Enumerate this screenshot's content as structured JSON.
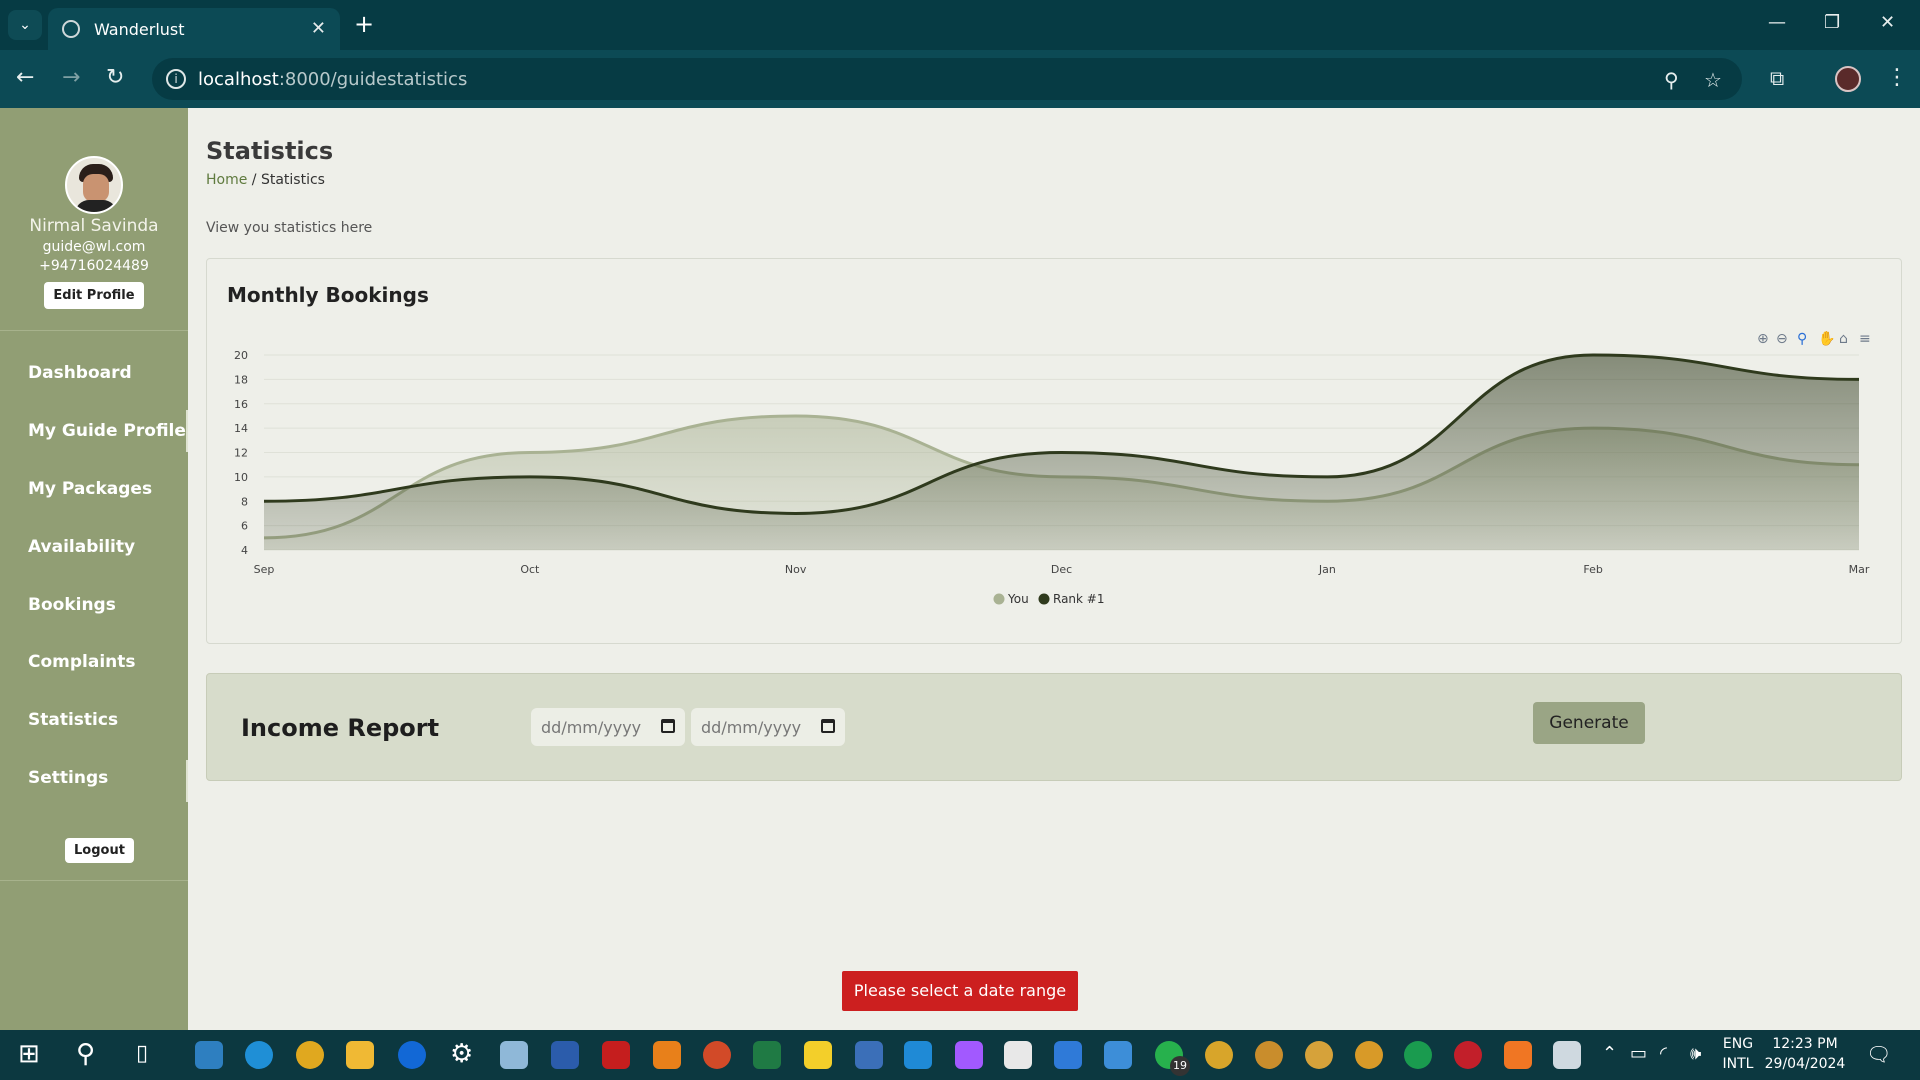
{
  "browser": {
    "tab_title": "Wanderlust",
    "url_host": "localhost",
    "url_path": ":8000/guidestatistics"
  },
  "profile": {
    "name": "Nirmal Savinda",
    "email": "guide@wl.com",
    "phone": "+94716024489",
    "edit_label": "Edit Profile"
  },
  "sidebar": {
    "items": [
      {
        "label": "Dashboard"
      },
      {
        "label": "My Guide Profile"
      },
      {
        "label": "My Packages"
      },
      {
        "label": "Availability"
      },
      {
        "label": "Bookings"
      },
      {
        "label": "Complaints"
      },
      {
        "label": "Statistics"
      },
      {
        "label": "Settings"
      }
    ],
    "logout_label": "Logout"
  },
  "page": {
    "title": "Statistics",
    "breadcrumb_home": "Home",
    "breadcrumb_sep": "/",
    "breadcrumb_current": "Statistics",
    "subtitle": "View you statistics here"
  },
  "chart_card": {
    "title": "Monthly Bookings"
  },
  "chart_data": {
    "type": "area",
    "categories": [
      "Sep",
      "Oct",
      "Nov",
      "Dec",
      "Jan",
      "Feb",
      "Mar"
    ],
    "series": [
      {
        "name": "You",
        "values": [
          5,
          12,
          15,
          10,
          8,
          14,
          11
        ]
      },
      {
        "name": "Rank #1",
        "values": [
          8,
          10,
          7,
          12,
          10,
          20,
          18
        ]
      }
    ],
    "yticks": [
      4,
      6,
      8,
      10,
      12,
      14,
      16,
      18,
      20
    ],
    "ylim": [
      4,
      20
    ],
    "grid": true,
    "legend": "bottom-center",
    "colors": {
      "You": "#a9b293",
      "Rank #1": "#2f3a1d"
    }
  },
  "income": {
    "title": "Income Report",
    "date_placeholder_1": "dd/mm/yyyy",
    "date_placeholder_2": "dd/mm/yyyy",
    "generate_label": "Generate"
  },
  "alert": {
    "message": "Please select a date range"
  },
  "taskbar": {
    "lang_top": "ENG",
    "lang_bottom": "INTL",
    "time": "12:23 PM",
    "date": "29/04/2024",
    "whatsapp_badge": "19"
  }
}
